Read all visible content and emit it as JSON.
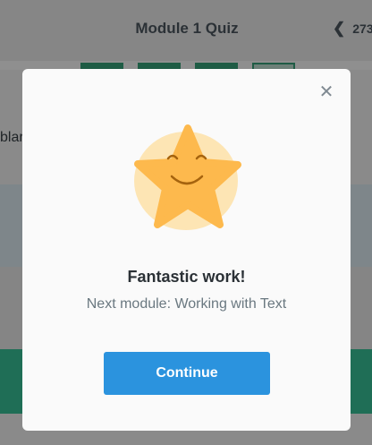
{
  "header": {
    "title": "Module 1 Quiz",
    "back_text": "273"
  },
  "background": {
    "partial_text": "blar"
  },
  "progress": {
    "segments": 4,
    "current_index": 3
  },
  "modal": {
    "close_label": "✕",
    "title": "Fantastic work!",
    "subtitle": "Next module: Working with Text",
    "continue_label": "Continue"
  },
  "colors": {
    "primary_button": "#2b93de",
    "star": "#fdb94d",
    "star_halo": "#fde5b4",
    "progress_complete": "#1f5c45"
  }
}
